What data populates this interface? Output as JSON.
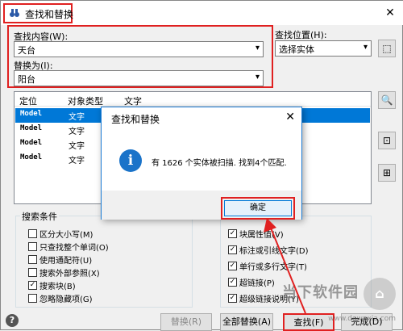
{
  "window": {
    "title": "查找和替换",
    "close_icon": "✕"
  },
  "find": {
    "label": "查找内容(W):",
    "value": "天台"
  },
  "replace": {
    "label": "替换为(I):",
    "value": "阳台"
  },
  "scope": {
    "label": "查找位置(H):",
    "value": "选择实体"
  },
  "list": {
    "headers": [
      "定位",
      "对象类型",
      "文字"
    ],
    "rows": [
      {
        "loc": "Model",
        "type": "文字",
        "text": ""
      },
      {
        "loc": "Model",
        "type": "文字",
        "text": ""
      },
      {
        "loc": "Model",
        "type": "文字",
        "text": ""
      },
      {
        "loc": "Model",
        "type": "文字",
        "text": ""
      }
    ]
  },
  "search_options": {
    "title": "搜索条件",
    "items": [
      {
        "label": "区分大小写(M)",
        "checked": false
      },
      {
        "label": "只查找整个单词(O)",
        "checked": false
      },
      {
        "label": "使用通配符(U)",
        "checked": false
      },
      {
        "label": "搜索外部参照(X)",
        "checked": false
      },
      {
        "label": "搜索块(B)",
        "checked": true
      },
      {
        "label": "忽略隐藏项(G)",
        "checked": false
      }
    ]
  },
  "text_types": {
    "items": [
      {
        "label": "块属性值(V)",
        "checked": true
      },
      {
        "label": "标注或引线文字(D)",
        "checked": true
      },
      {
        "label": "单行或多行文字(T)",
        "checked": true
      },
      {
        "label": "超链接(P)",
        "checked": true
      },
      {
        "label": "超级链接说明(Y)",
        "checked": true
      }
    ]
  },
  "buttons": {
    "help": "?",
    "replace": "替换(R)",
    "replace_all": "全部替换(A)",
    "find": "查找(F)",
    "done": "完成(D)"
  },
  "dialog": {
    "title": "查找和替换",
    "close": "✕",
    "icon": "i",
    "message": "有 1626 个实体被扫描. 找到4个匹配.",
    "ok": "确定"
  },
  "watermark": {
    "brand": "当下软件园",
    "url": "www.downxia.com"
  },
  "colors": {
    "highlight": "#e02020",
    "selection": "#0078d7",
    "info": "#1a73c9"
  }
}
